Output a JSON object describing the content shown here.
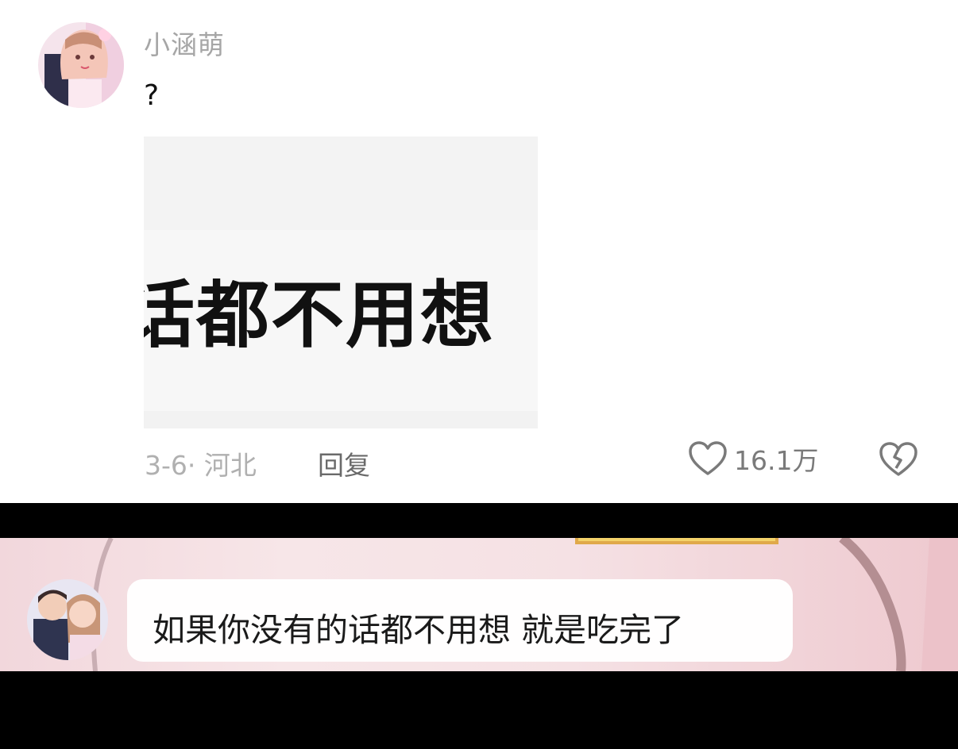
{
  "comment": {
    "username": "小涵萌",
    "text": "?",
    "image_text": "话都不用想",
    "date_location": "3-6· 河北",
    "reply_label": "回复",
    "like_count": "16.1万"
  },
  "video": {
    "caption": "如果你没有的话都不用想 就是吃完了"
  },
  "icons": {
    "like": "heart-outline-icon",
    "dislike": "broken-heart-icon"
  },
  "colors": {
    "username": "#a6a6a6",
    "meta": "#b0b0b0",
    "reply": "#6a6a6a",
    "video_bg": "#f5e1e4"
  }
}
